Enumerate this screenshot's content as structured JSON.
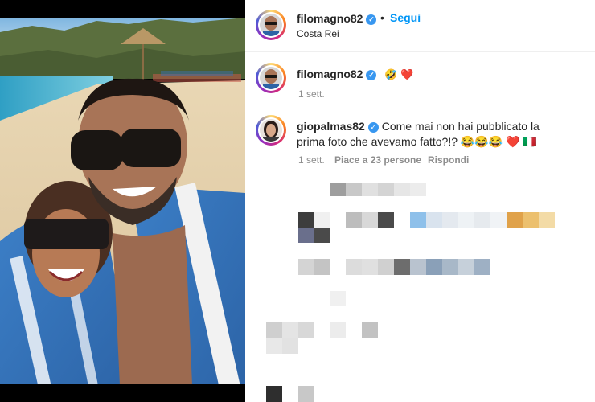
{
  "post": {
    "author": "filomagno82",
    "follow_label": "Segui",
    "separator": "•",
    "location": "Costa Rei"
  },
  "caption": {
    "author": "filomagno82",
    "text": "🤣 ❤️",
    "time": "1 sett."
  },
  "comment": {
    "author": "giopalmas82",
    "text": "Come mai non hai pubblicato la prima foto che avevamo fatto?!? 😂😂😂 ❤️ 🇮🇹",
    "time": "1 sett.",
    "likes": "Piace a 23 persone",
    "reply": "Rispondi"
  },
  "colors": {
    "accent": "#0095f6",
    "verified": "#3897f0",
    "muted": "#8e8e8e"
  },
  "icons": [
    "verified-badge-icon",
    "heart-emoji-icon"
  ]
}
